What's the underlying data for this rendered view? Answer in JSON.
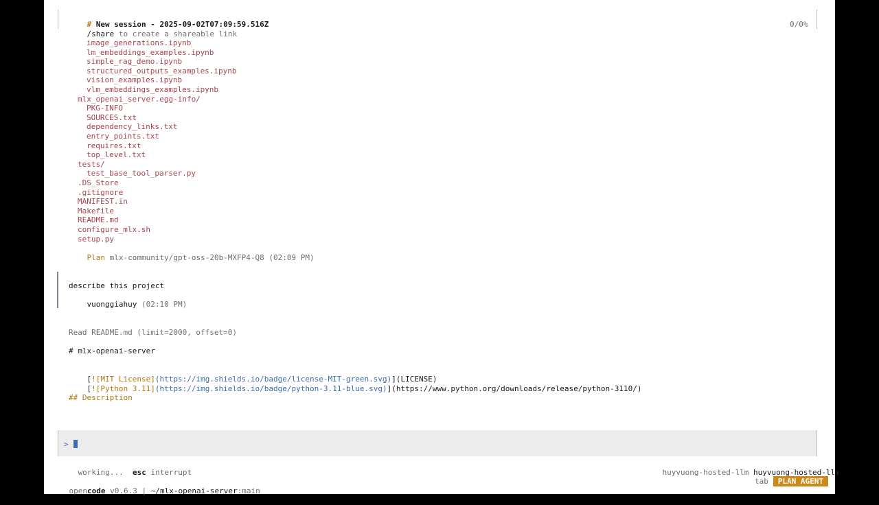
{
  "header": {
    "hash": "#",
    "title": "New session - 2025-09-02T07:09:59.516Z",
    "share_cmd": "/share",
    "share_text": "to create a shareable link",
    "context_usage": "0/0%"
  },
  "file_tree": [
    "image_generations.ipynb",
    "lm_embeddings_examples.ipynb",
    "simple_rag_demo.ipynb",
    "structured_outputs_examples.ipynb",
    "vision_examples.ipynb",
    "vlm_embeddings_examples.ipynb",
    "mlx_openai_server.egg-info/",
    "PKG-INFO",
    "SOURCES.txt",
    "dependency_links.txt",
    "entry_points.txt",
    "requires.txt",
    "top_level.txt",
    "tests/",
    "test_base_tool_parser.py",
    ".DS_Store",
    ".gitignore",
    "MANIFEST.in",
    "Makefile",
    "README.md",
    "configure_mlx.sh",
    "setup.py"
  ],
  "plan_meta": {
    "mode": "Plan",
    "model": "mlx-community/gpt-oss-20b-MXFP4-Q8",
    "time": "(02:09 PM)"
  },
  "user_message": {
    "text": "describe this project",
    "user": "vuonggiahuy",
    "time": "(02:10 PM)"
  },
  "tool_call": "Read README.md (limit=2000, offset=0)",
  "readme": {
    "heading": "# mlx-openai-server",
    "badge1_open": "[",
    "badge1_alt": "![MIT License]",
    "badge1_url": "(https://img.shields.io/badge/license-MIT-green.svg)",
    "badge1_close": "](LICENSE)",
    "badge2_open": "[",
    "badge2_alt": "![Python 3.11]",
    "badge2_url": "(https://img.shields.io/badge/python-3.11-blue.svg)",
    "badge2_close": "](https://www.python.org/downloads/release/python-3110/)",
    "subheading": "## Description"
  },
  "prompt": {
    "symbol": ">"
  },
  "status": {
    "working": "working...",
    "esc_key": "esc",
    "esc_action": "interrupt",
    "provider": "huyvuong-hosted-llm",
    "model": "huyvuong-hosted-llm"
  },
  "footer": {
    "brand_open": "open",
    "brand_code": "code",
    "version": "v0.6.3",
    "path": "~/mlx-openai-server",
    "branch": ":main",
    "tab_hint": "tab",
    "agent_badge": "PLAN AGENT"
  },
  "colors": {
    "accent_orange": "#c98a1a",
    "file_red": "#a8434d",
    "link_blue": "#3b6db0"
  }
}
